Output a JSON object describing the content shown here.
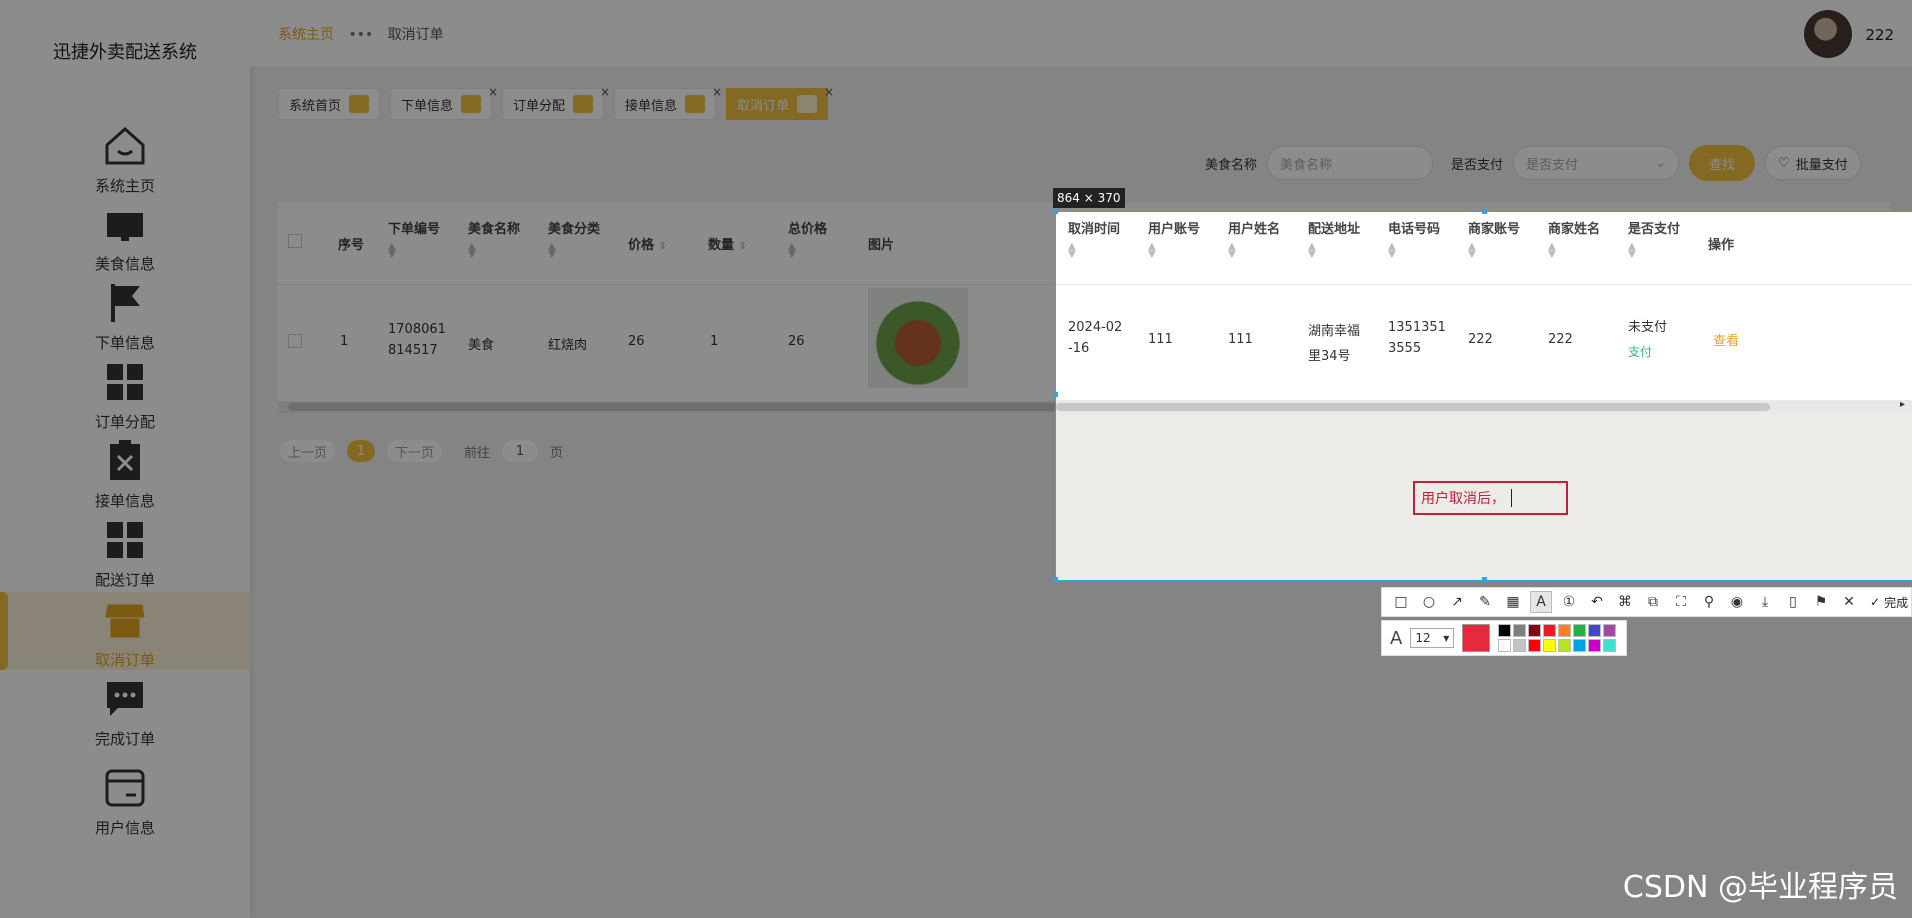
{
  "app": {
    "title": "迅捷外卖配送系统"
  },
  "sidebar": {
    "items": [
      {
        "label": "系统主页",
        "icon": "home-icon"
      },
      {
        "label": "美食信息",
        "icon": "monitor-icon"
      },
      {
        "label": "下单信息",
        "icon": "flag-icon"
      },
      {
        "label": "订单分配",
        "icon": "grid-icon"
      },
      {
        "label": "接单信息",
        "icon": "clipboard-x-icon"
      },
      {
        "label": "配送订单",
        "icon": "grid-icon"
      },
      {
        "label": "取消订单",
        "icon": "store-icon",
        "active": true
      },
      {
        "label": "完成订单",
        "icon": "chat-icon"
      },
      {
        "label": "用户信息",
        "icon": "card-icon"
      }
    ]
  },
  "header": {
    "breadcrumb": {
      "home": "系统主页",
      "current": "取消订单"
    },
    "username": "222"
  },
  "tabs": [
    {
      "label": "系统首页"
    },
    {
      "label": "下单信息"
    },
    {
      "label": "订单分配"
    },
    {
      "label": "接单信息"
    },
    {
      "label": "取消订单",
      "active": true
    }
  ],
  "search": {
    "food_label": "美食名称",
    "food_placeholder": "美食名称",
    "paid_label": "是否支付",
    "paid_placeholder": "是否支付",
    "search_button": "查找",
    "batch_pay_button": "批量支付"
  },
  "table": {
    "columns": [
      "序号",
      "下单编号",
      "美食名称",
      "美食分类",
      "价格",
      "数量",
      "总价格",
      "图片"
    ],
    "row": {
      "index": "1",
      "order_no_1": "1708061",
      "order_no_2": "814517",
      "food": "美食",
      "category": "红烧肉",
      "price": "26",
      "qty": "1",
      "total": "26"
    }
  },
  "capture_table": {
    "columns": [
      "取消时间",
      "用户账号",
      "用户姓名",
      "配送地址",
      "电话号码",
      "商家账号",
      "商家姓名",
      "是否支付",
      "操作"
    ],
    "row": {
      "time_1": "2024-02",
      "time_2": "-16",
      "account": "111",
      "name": "111",
      "addr_1": "湖南幸福",
      "addr_2": "里34号",
      "phone_1": "1351351",
      "phone_2": "3555",
      "merchant_account": "222",
      "merchant_name": "222",
      "paid_status": "未支付",
      "pay_link": "支付",
      "view_link": "查看"
    }
  },
  "pager": {
    "prev": "上一页",
    "current": "1",
    "next": "下一页",
    "goto": "前往",
    "page_input": "1",
    "page_unit": "页"
  },
  "screenshot_tool": {
    "size_label": "864 × 370",
    "annotation_text": "用户取消后，",
    "font_size": "12",
    "done_label": "完成",
    "current_color": "#e8283d",
    "palette": [
      "#000000",
      "#7f7f7f",
      "#880015",
      "#ed1c24",
      "#ff7f27",
      "#22b14c",
      "#3f48cc",
      "#a349a4",
      "#ffffff",
      "#c3c3c3",
      "#ff0000",
      "#ffff00",
      "#b5e61d",
      "#00a2e8",
      "#c800c8",
      "#40e0d0"
    ]
  },
  "watermark": "CSDN @毕业程序员"
}
